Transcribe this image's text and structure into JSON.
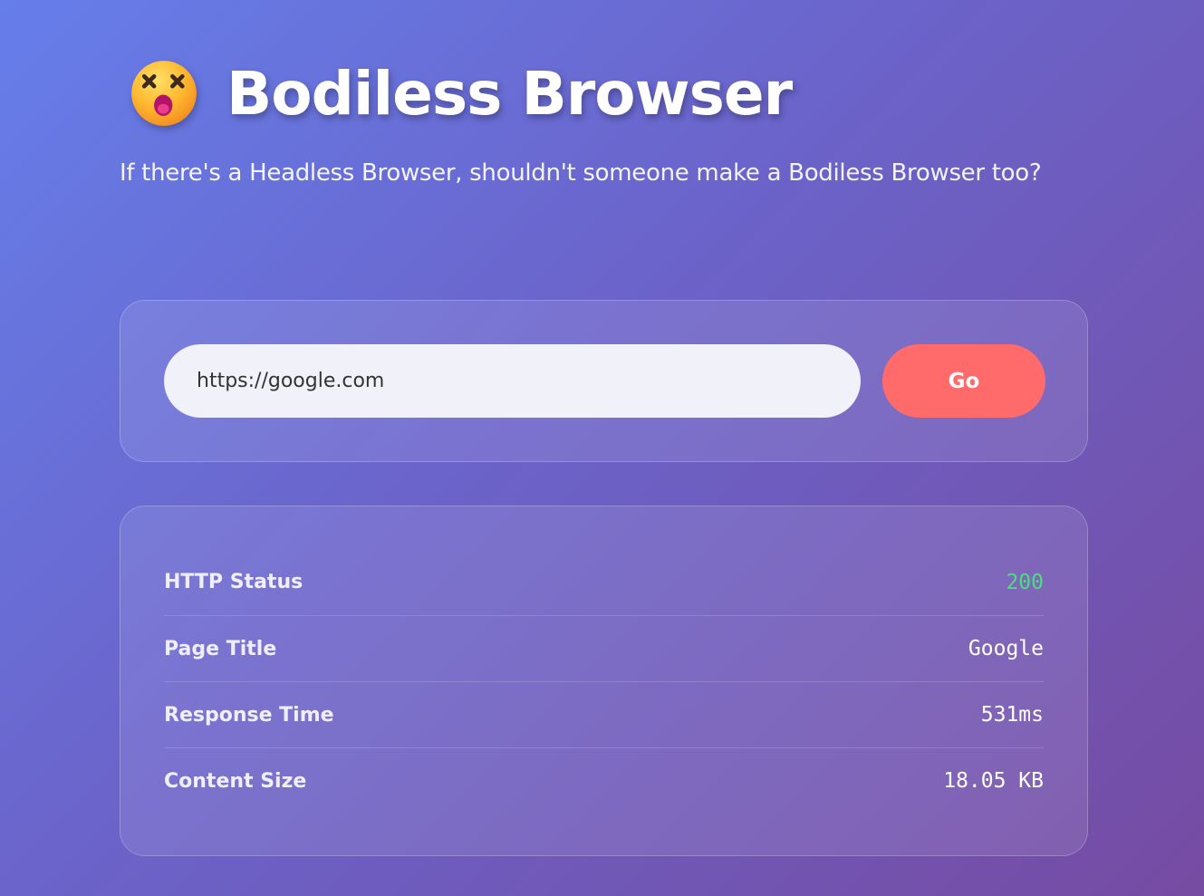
{
  "header": {
    "emoji_icon": "dizzy-face-emoji",
    "title": "Bodiless Browser",
    "subtitle": "If there's a Headless Browser, shouldn't someone make a Bodiless Browser too?"
  },
  "search": {
    "url_value": "https://google.com",
    "go_label": "Go"
  },
  "results": {
    "rows": [
      {
        "label": "HTTP Status",
        "value": "200",
        "value_color": "#4ade80"
      },
      {
        "label": "Page Title",
        "value": "Google"
      },
      {
        "label": "Response Time",
        "value": "531ms"
      },
      {
        "label": "Content Size",
        "value": "18.05 KB"
      }
    ]
  },
  "colors": {
    "background_start": "#667eea",
    "background_end": "#764ba2",
    "accent_button": "#ff6b6b",
    "status_ok": "#4ade80"
  }
}
